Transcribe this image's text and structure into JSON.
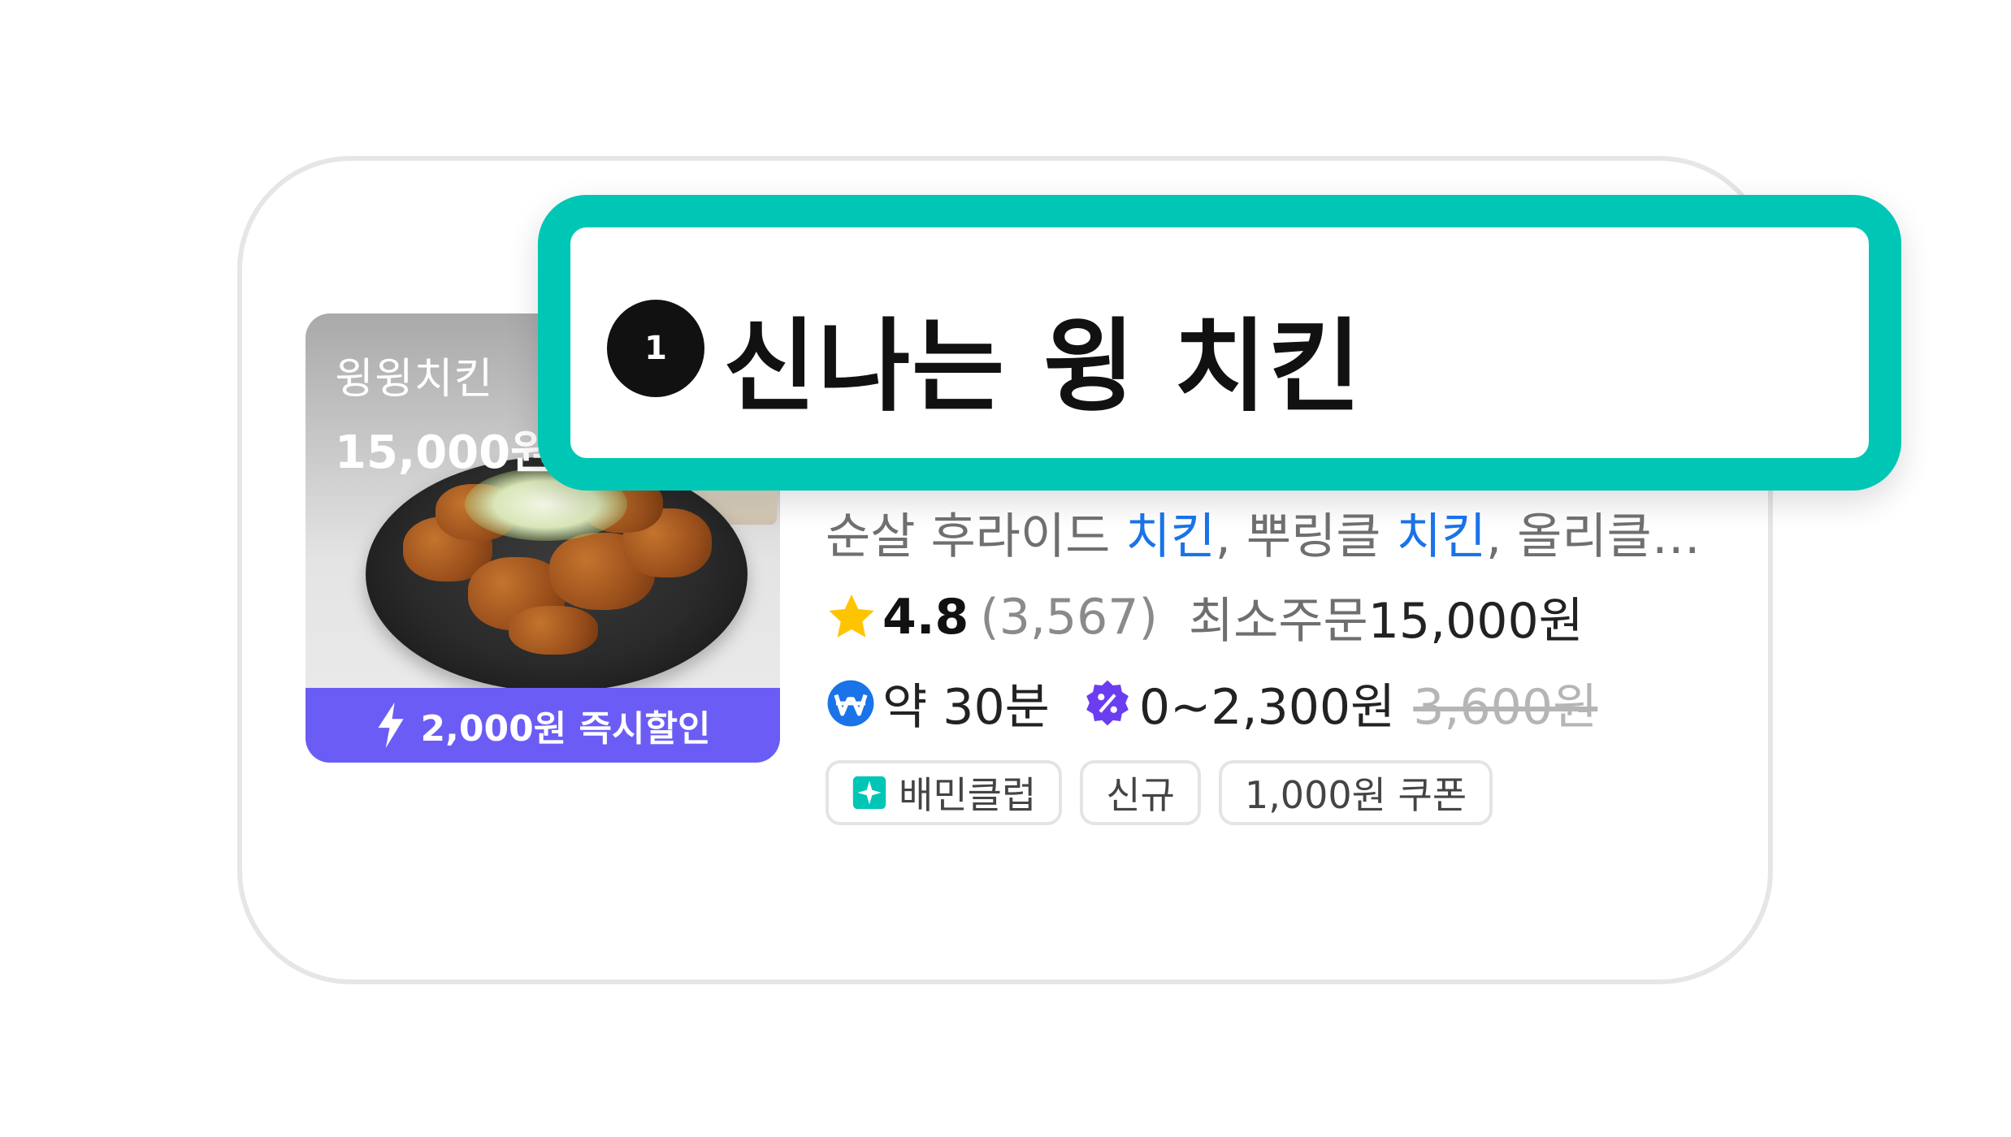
{
  "card": {
    "thumbnail": {
      "menu_name": "윙윙치킨",
      "menu_price": "15,000원",
      "promo_label": "2,000원 즉시할인",
      "promo_icon": "lightning-icon",
      "promo_color": "#6b5cf5"
    },
    "rank_number": "1",
    "store_name": "신나는 윙 치킨",
    "highlight_border_color": "#00c6b6",
    "menu_line": {
      "part1": "순살 후라이드 ",
      "hl1": "치킨",
      "part2": ", 뿌링클 ",
      "hl2": "치킨",
      "part3": ", 올리클…"
    },
    "rating": {
      "icon": "star-icon",
      "score": "4.8",
      "count": "(3,567)",
      "min_order_label": "최소주문",
      "min_order_value": "15,000원"
    },
    "delivery": {
      "time_icon": "delivery-won-icon",
      "time": "약 30분",
      "fee_icon": "discount-badge-icon",
      "fee": "0~2,300원",
      "original_fee": "3,600원"
    },
    "tags": [
      {
        "label": "배민클럽",
        "icon": "baemin-club-icon"
      },
      {
        "label": "신규"
      },
      {
        "label": "1,000원 쿠폰"
      }
    ]
  }
}
